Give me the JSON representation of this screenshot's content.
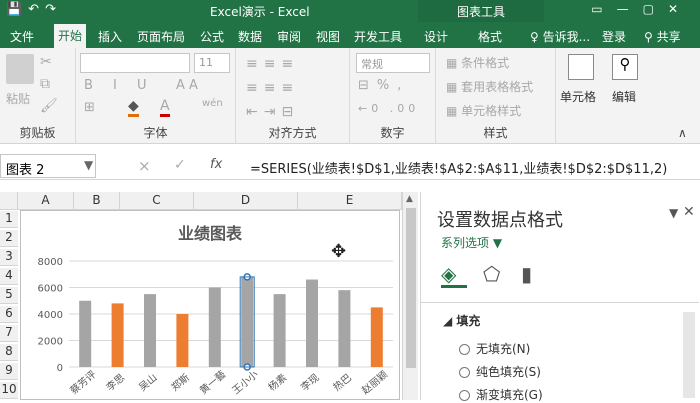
{
  "titlebar": {
    "app_title": "Excel演示 - Excel",
    "context_title": "图表工具"
  },
  "tabs": [
    "文件",
    "开始",
    "插入",
    "页面布局",
    "公式",
    "数据",
    "审阅",
    "视图",
    "开发工具",
    "设计",
    "格式"
  ],
  "active_tab": "开始",
  "tell_me": "告诉我...",
  "login": "登录",
  "share": "共享",
  "ribbon": {
    "paste": "粘贴",
    "clipboard_label": "剪贴板",
    "font_size": "11",
    "font_label": "字体",
    "wen_label": "wén",
    "align_label": "对齐方式",
    "number_format": "常规",
    "number_label": "数字",
    "cond_format": "条件格式",
    "table_format": "套用表格格式",
    "cell_style": "单元格样式",
    "styles_label": "样式",
    "cells": "单元格",
    "editing": "编辑"
  },
  "formula_bar": {
    "name_box": "图表 2",
    "cancel": "×",
    "enter": "✓",
    "fx": "fx",
    "formula": "=SERIES(业绩表!$D$1,业绩表!$A$2:$A$11,业绩表!$D$2:$D$11,2)"
  },
  "columns": [
    "A",
    "B",
    "C",
    "D",
    "E"
  ],
  "rows": [
    "1",
    "2",
    "3",
    "4",
    "5",
    "6",
    "7",
    "8",
    "9",
    "10"
  ],
  "chart_data": {
    "type": "bar",
    "title": "业绩图表",
    "categories": [
      "蔡芳评",
      "李思",
      "吴山",
      "郑斯",
      "黄一藝",
      "王小小",
      "杨素",
      "李现",
      "热巴",
      "赵丽颖"
    ],
    "values": [
      5000,
      4800,
      5500,
      4000,
      6000,
      6800,
      5500,
      6600,
      5800,
      4500
    ],
    "highlighted": [
      1,
      3,
      9
    ],
    "selected": 5,
    "ylim": [
      0,
      8000
    ],
    "yticks": [
      "0",
      "2000",
      "4000",
      "6000",
      "8000"
    ],
    "colors": {
      "normal": "#a5a5a5",
      "highlight": "#ed7d31",
      "gridline": "#d9d9d9"
    }
  },
  "pane": {
    "title": "设置数据点格式",
    "series_options": "系列选项",
    "section": "填充",
    "options": [
      {
        "label": "无填充(N)"
      },
      {
        "label": "纯色填充(S)"
      },
      {
        "label": "渐变填充(G)"
      }
    ]
  }
}
